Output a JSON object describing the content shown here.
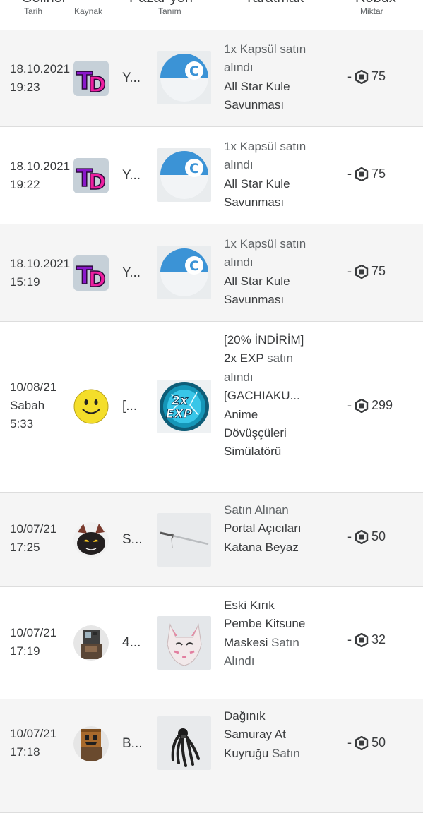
{
  "header": {
    "columns": [
      {
        "title": "Gelirlei",
        "sub": "Tarih"
      },
      {
        "title": "",
        "sub": "Kaynak"
      },
      {
        "title": "Pazar yeri",
        "sub": "Tanım"
      },
      {
        "title": "Yaratmak",
        "sub": ""
      },
      {
        "title": "Robux",
        "sub": "Miktar"
      }
    ]
  },
  "rows": [
    {
      "date_line1": "18.10.2021",
      "date_line2": "19:23",
      "date_line3": "",
      "source_icon": "td-logo-icon",
      "source": "Y...",
      "item_icon": "capsule-icon",
      "desc_light": "1x Kapsül satın alındı",
      "desc_strong": "All Star Kule Savunması",
      "desc_tail": "",
      "sign": "-",
      "amount": "75"
    },
    {
      "date_line1": "18.10.2021",
      "date_line2": "19:22",
      "date_line3": "",
      "source_icon": "td-logo-icon",
      "source": "Y...",
      "item_icon": "capsule-icon",
      "desc_light": "1x Kapsül satın alındı",
      "desc_strong": "All Star Kule Savunması",
      "desc_tail": "",
      "sign": "-",
      "amount": "75"
    },
    {
      "date_line1": "18.10.2021",
      "date_line2": "15:19",
      "date_line3": "",
      "source_icon": "td-logo-icon",
      "source": "Y...",
      "item_icon": "capsule-icon",
      "desc_light": "1x Kapsül satın alındı",
      "desc_strong": "All Star Kule Savunması",
      "desc_tail": "",
      "sign": "-",
      "amount": "75"
    },
    {
      "date_line1": "10/08/21",
      "date_line2": "Sabah",
      "date_line3": "5:33",
      "source_icon": "smiley-icon",
      "source": "[...",
      "item_icon": "exp-badge-icon",
      "desc_pre": "[20% İNDİRİM] 2x EXP",
      "desc_light": " satın alındı",
      "desc_strong": "[GACHIAKU... Anime Dövüşçüleri Simülatörü",
      "desc_tail": "",
      "sign": "-",
      "amount": "299"
    },
    {
      "date_line1": "10/07/21",
      "date_line2": "17:25",
      "date_line3": "",
      "source_icon": "cat-avatar-icon",
      "source": "S...",
      "item_icon": "katana-icon",
      "desc_light": "Satın Alınan",
      "desc_strong": "Portal Açıcıları Katana Beyaz",
      "desc_tail": "",
      "sign": "-",
      "amount": "50"
    },
    {
      "date_line1": "10/07/21",
      "date_line2": "17:19",
      "date_line3": "",
      "source_icon": "blocky-avatar-icon",
      "source": "4...",
      "item_icon": "kitsune-mask-icon",
      "desc_light": "",
      "desc_strong": "Eski Kırık Pembe Kitsune Maskesi",
      "desc_tail": " Satın Alındı",
      "sign": "-",
      "amount": "32"
    },
    {
      "date_line1": "10/07/21",
      "date_line2": "17:18",
      "date_line3": "",
      "source_icon": "box-head-avatar-icon",
      "source": "B...",
      "item_icon": "samurai-tail-icon",
      "desc_light": "",
      "desc_strong": "Dağınık Samuray At Kuyruğu",
      "desc_tail": " Satın",
      "sign": "-",
      "amount": "50"
    }
  ]
}
